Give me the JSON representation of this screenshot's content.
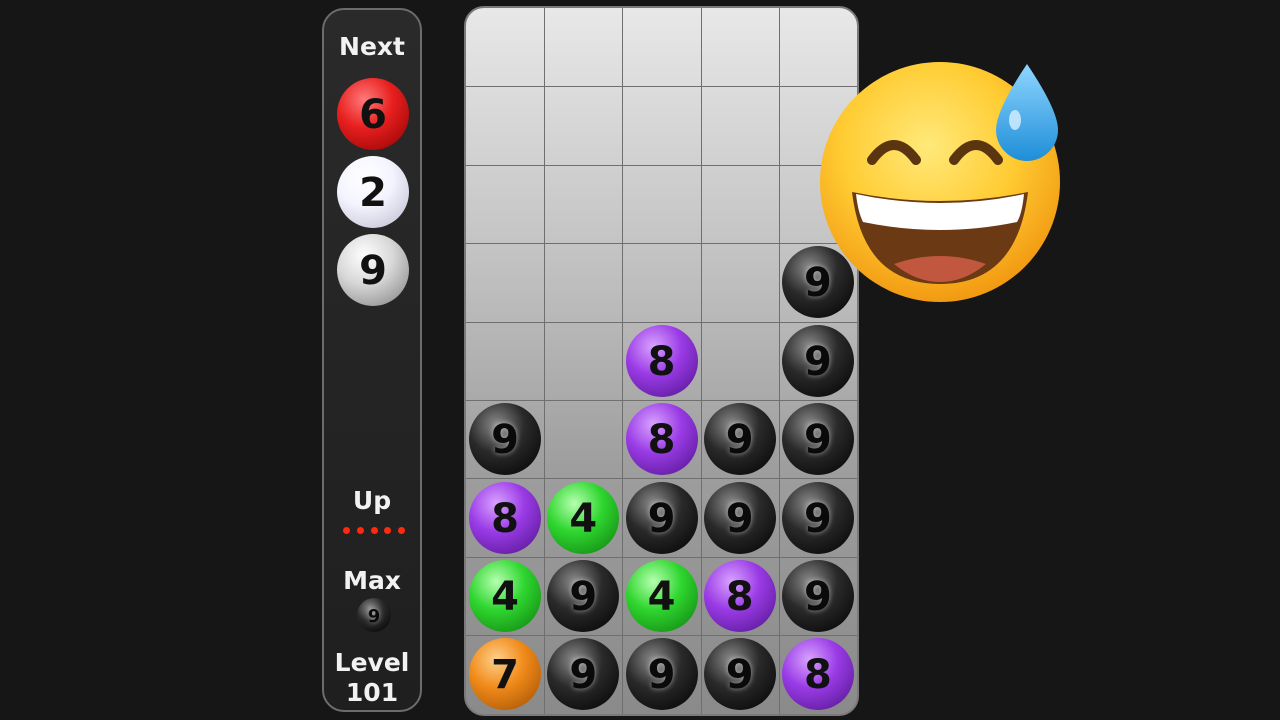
{
  "panel": {
    "next_label": "Next",
    "next_balls": [
      {
        "value": "6",
        "color": "red"
      },
      {
        "value": "2",
        "color": "white"
      },
      {
        "value": "9",
        "color": "silver"
      }
    ],
    "up_label": "Up",
    "up_dots_count": 5,
    "max_label": "Max",
    "max_ball": {
      "value": "9",
      "color": "black"
    },
    "level_label": "Level",
    "level_value": "101"
  },
  "board": {
    "columns": 5,
    "rows": 9,
    "grid": [
      [
        null,
        null,
        null,
        null,
        null
      ],
      [
        null,
        null,
        null,
        null,
        null
      ],
      [
        null,
        null,
        null,
        null,
        null
      ],
      [
        null,
        null,
        null,
        null,
        {
          "value": "9",
          "color": "black"
        }
      ],
      [
        null,
        null,
        {
          "value": "8",
          "color": "purple"
        },
        null,
        {
          "value": "9",
          "color": "black"
        }
      ],
      [
        {
          "value": "9",
          "color": "black"
        },
        null,
        {
          "value": "8",
          "color": "purple"
        },
        {
          "value": "9",
          "color": "black"
        },
        {
          "value": "9",
          "color": "black"
        }
      ],
      [
        {
          "value": "8",
          "color": "purple"
        },
        {
          "value": "4",
          "color": "green"
        },
        {
          "value": "9",
          "color": "black"
        },
        {
          "value": "9",
          "color": "black"
        },
        {
          "value": "9",
          "color": "black"
        }
      ],
      [
        {
          "value": "4",
          "color": "green"
        },
        {
          "value": "9",
          "color": "black"
        },
        {
          "value": "4",
          "color": "green"
        },
        {
          "value": "8",
          "color": "purple"
        },
        {
          "value": "9",
          "color": "black"
        }
      ],
      [
        {
          "value": "7",
          "color": "orange"
        },
        {
          "value": "9",
          "color": "black"
        },
        {
          "value": "9",
          "color": "black"
        },
        {
          "value": "9",
          "color": "black"
        },
        {
          "value": "8",
          "color": "purple"
        }
      ]
    ]
  },
  "emoji": {
    "name": "grinning-face-with-sweat"
  },
  "palette": {
    "red": "#e81f1f",
    "white": "#f4f4ff",
    "silver": "#d8d8d8",
    "black": "#2a2a2a",
    "purple": "#9a3be6",
    "green": "#2fd62f",
    "orange": "#f08a1a",
    "up_dot": "#ff2a0e"
  }
}
